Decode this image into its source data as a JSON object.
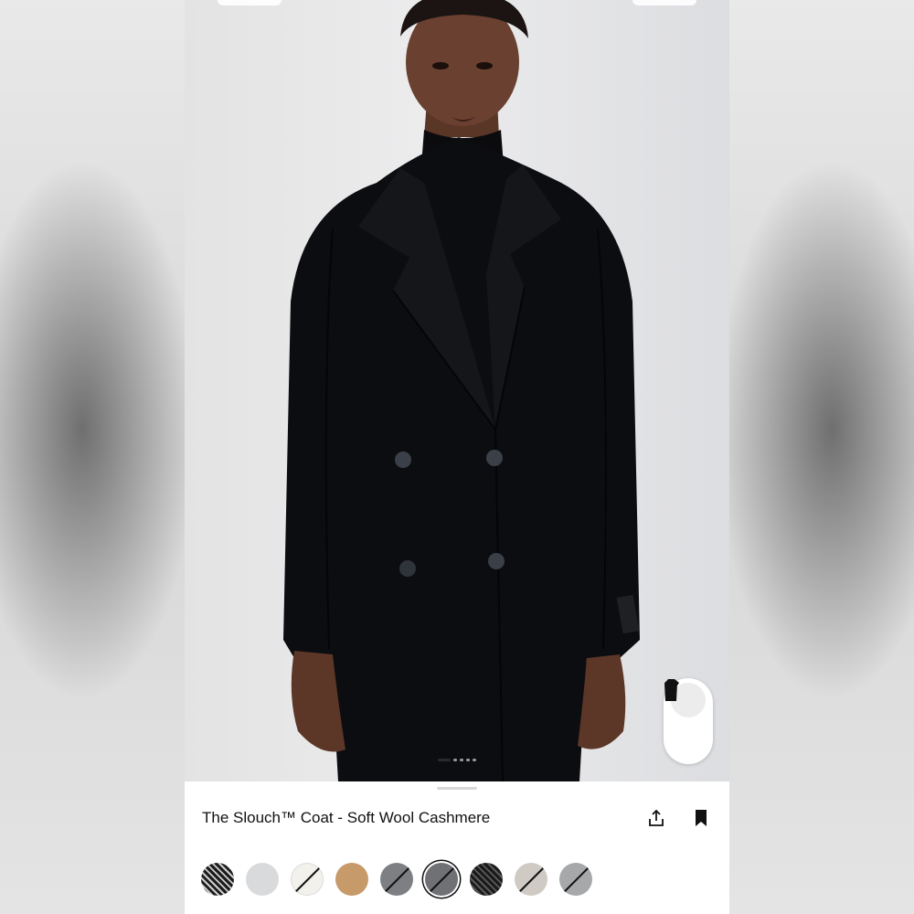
{
  "product": {
    "title": "The Slouch™ Coat - Soft Wool Cashmere"
  },
  "gallery": {
    "total_images": 5,
    "active_index": 0,
    "view_toggle": [
      {
        "icon": "full-length-coat-icon",
        "active": true
      },
      {
        "icon": "cropped-jacket-icon",
        "active": false
      }
    ]
  },
  "actions": {
    "share_icon": "share-icon",
    "save_icon": "bookmark-icon"
  },
  "colors": {
    "accent": "#111111",
    "coat": "#0c0d10",
    "backdrop": "#e6e7e9"
  },
  "swatches": [
    {
      "pattern": "herringbone-black-white",
      "available": true,
      "selected": false
    },
    {
      "color": "#d9dadb",
      "available": true,
      "selected": false
    },
    {
      "color": "#f3f1ec",
      "available": false,
      "selected": false
    },
    {
      "color": "#c79a6a",
      "available": true,
      "selected": false
    },
    {
      "color": "#7d7f82",
      "available": false,
      "selected": false
    },
    {
      "color": "#6f7174",
      "available": false,
      "selected": true
    },
    {
      "pattern": "herringbone-dark",
      "available": true,
      "selected": false
    },
    {
      "color": "#cfcac3",
      "available": false,
      "selected": false
    },
    {
      "color": "#a7a8aa",
      "available": false,
      "selected": false
    }
  ]
}
